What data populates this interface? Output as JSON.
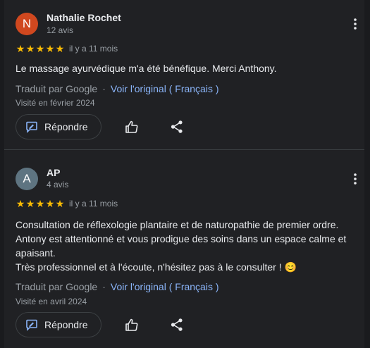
{
  "colors": {
    "background": "#202124",
    "text_primary": "#e8eaed",
    "text_secondary": "#9aa0a6",
    "link": "#8ab4f8",
    "star": "#fbbc04"
  },
  "reviews": [
    {
      "avatar_letter": "N",
      "avatar_color": "#d0481f",
      "name": "Nathalie Rochet",
      "review_count": "12 avis",
      "rating": 5,
      "date": "il y a 11 mois",
      "text": [
        "Le massage ayurvédique m'a été bénéfique. Merci Anthony."
      ],
      "translated_label": "Traduit par Google",
      "separator": "·",
      "original_link": "Voir l'original ( Français )",
      "visited": "Visité en février 2024",
      "reply_label": "Répondre"
    },
    {
      "avatar_letter": "A",
      "avatar_color": "#5e7481",
      "name": "AP",
      "review_count": "4 avis",
      "rating": 5,
      "date": "il y a 11 mois",
      "text": [
        "Consultation de réflexologie plantaire et de naturopathie de premier ordre.",
        "Antony est attentionné et vous prodigue des soins dans un espace calme et",
        "apaisant.",
        "Très professionnel et à l'écoute, n'hésitez pas à le consulter ! 😊"
      ],
      "translated_label": "Traduit par Google",
      "separator": "·",
      "original_link": "Voir l'original ( Français )",
      "visited": "Visité en avril 2024",
      "reply_label": "Répondre"
    }
  ],
  "icons": {
    "more": "more-vert-icon",
    "reply": "reply-edit-icon",
    "like": "thumb-up-icon",
    "share": "share-icon",
    "star": "star-icon"
  }
}
